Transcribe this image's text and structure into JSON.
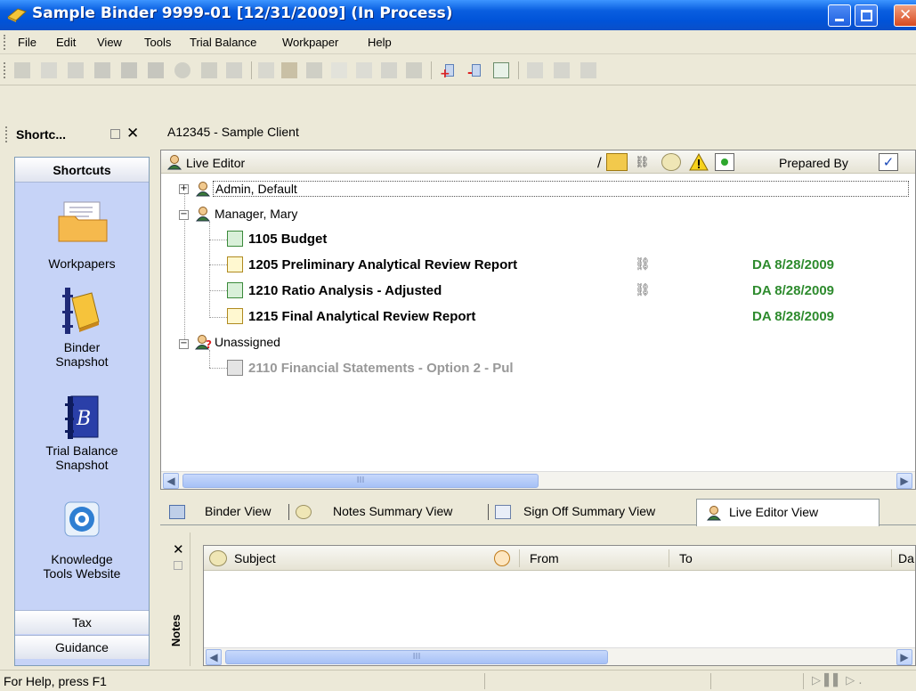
{
  "window": {
    "title": "Sample Binder 9999-01 [12/31/2009] (In Process)"
  },
  "menu": [
    "File",
    "Edit",
    "View",
    "Tools",
    "Trial Balance",
    "Workpaper",
    "Help"
  ],
  "shortcuts_panel": {
    "title": "Shortc...",
    "header": "Shortcuts",
    "items": [
      {
        "label_line1": "Workpapers",
        "label_line2": "",
        "icon": "folder-icon"
      },
      {
        "label_line1": "Binder",
        "label_line2": "Snapshot",
        "icon": "binder-icon"
      },
      {
        "label_line1": "Trial Balance",
        "label_line2": "Snapshot",
        "icon": "trial-balance-icon"
      },
      {
        "label_line1": "Knowledge",
        "label_line2": "Tools Website",
        "icon": "knowledge-icon"
      }
    ],
    "footer_tabs": [
      "Tax",
      "Guidance"
    ]
  },
  "client": "A12345 - Sample Client",
  "live_editor": {
    "header": "Live Editor",
    "sort_mark": "/",
    "prepared_by": "Prepared By",
    "groups": [
      {
        "name": "Admin, Default",
        "expanded": false,
        "items": []
      },
      {
        "name": "Manager, Mary",
        "expanded": true,
        "items": [
          {
            "title": "1105 Budget",
            "linked": false,
            "signoff": ""
          },
          {
            "title": "1205 Preliminary Analytical Review Report",
            "linked": true,
            "signoff": "DA 8/28/2009"
          },
          {
            "title": "1210 Ratio Analysis - Adjusted",
            "linked": true,
            "signoff": "DA 8/28/2009"
          },
          {
            "title": "1215 Final Analytical Review Report",
            "linked": false,
            "signoff": "DA 8/28/2009"
          }
        ]
      },
      {
        "name": "Unassigned",
        "expanded": true,
        "items": [
          {
            "title": "2110 Financial Statements - Option 2 - Pul",
            "linked": false,
            "signoff": ""
          }
        ]
      }
    ],
    "scroll_mark": "III"
  },
  "view_tabs": [
    "Binder View",
    "Notes Summary View",
    "Sign Off Summary View",
    "Live Editor View"
  ],
  "notes": {
    "side_label": "Notes",
    "columns": [
      "Subject",
      "From",
      "To",
      "Da"
    ],
    "scroll_mark": "III"
  },
  "status": {
    "text": "For Help, press F1"
  },
  "colors": {
    "title_bar": "#0053d8",
    "signoff_green": "#2e8b2e",
    "shortcut_bg": "#c6d3f7"
  }
}
